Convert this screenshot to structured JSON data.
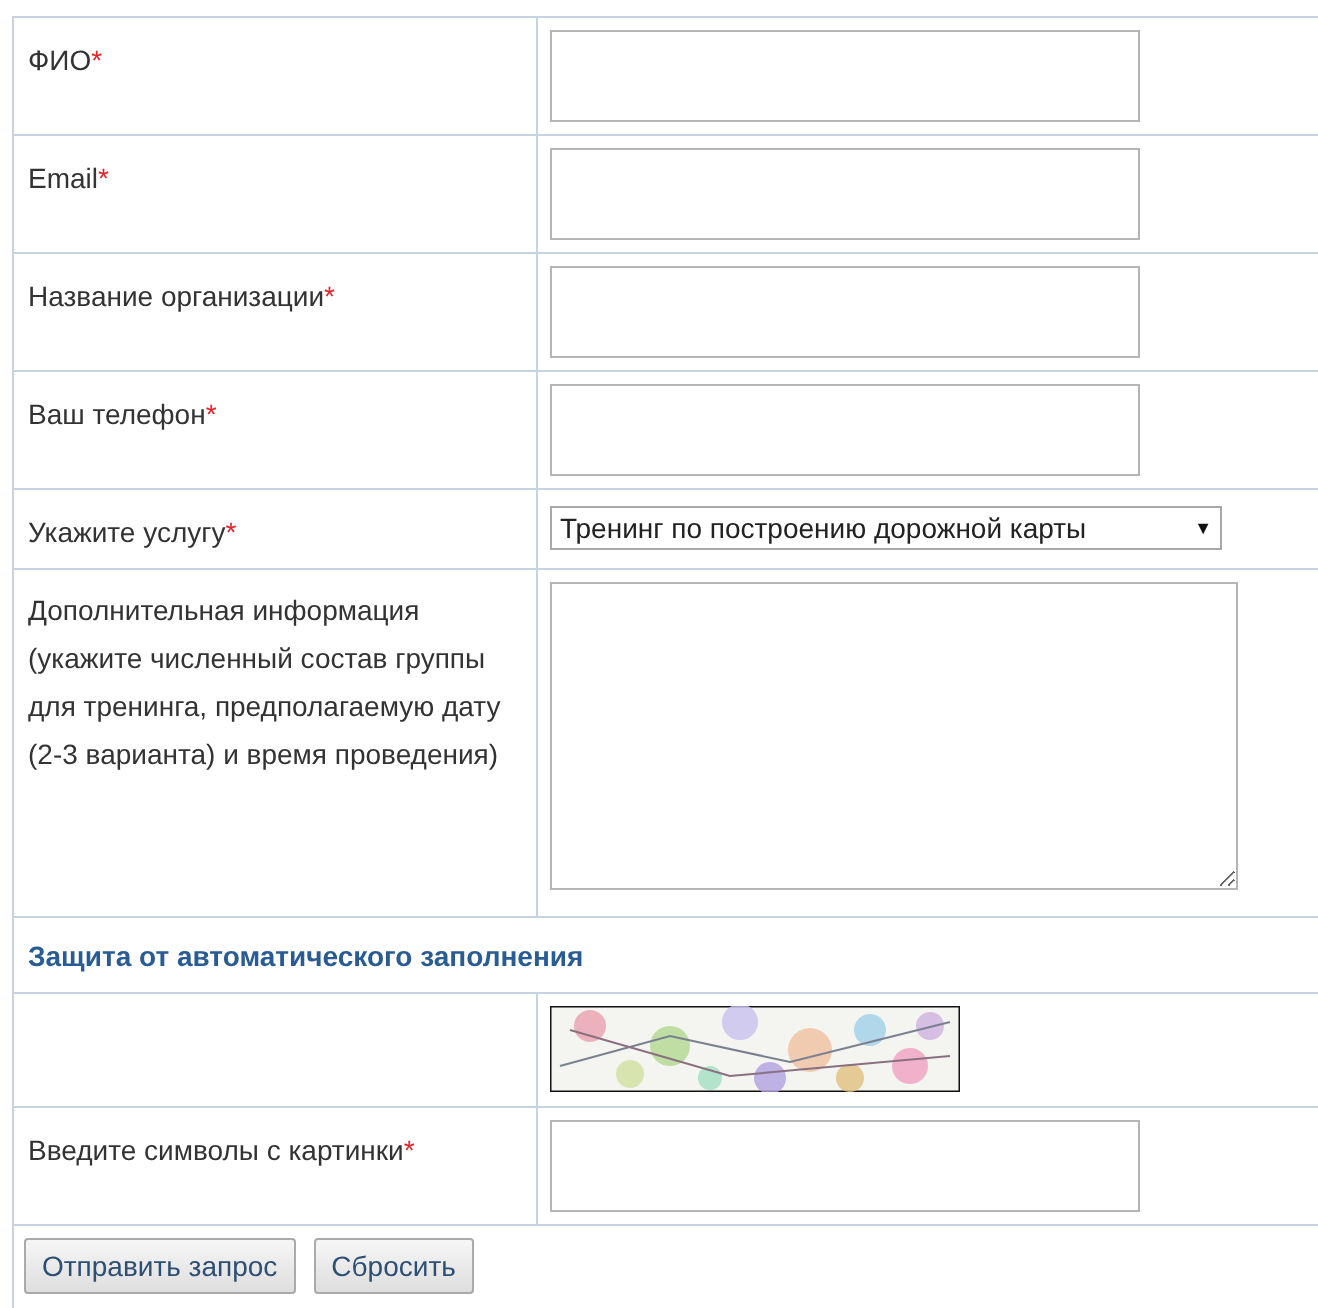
{
  "rows": [
    {
      "kind": "text",
      "label": "ФИО",
      "required_mark": "*"
    },
    {
      "kind": "text",
      "label": "Email",
      "required_mark": "*"
    },
    {
      "kind": "text",
      "label": "Название организации",
      "required_mark": "*"
    },
    {
      "kind": "text",
      "label": "Ваш телефон",
      "required_mark": "*"
    },
    {
      "kind": "select",
      "label": "Укажите услугу",
      "required_mark": "*",
      "value": "Тренинг по построению дорожной карты",
      "arrow": "▼"
    },
    {
      "kind": "textarea",
      "label": "Дополнительная информация (укажите численный состав группы для тренинга, предполагаемую дату (2-3 варианта) и время проведения)"
    },
    {
      "kind": "section",
      "label": "Защита от автоматического заполнения"
    },
    {
      "kind": "captcha"
    },
    {
      "kind": "text",
      "label": "Введите символы с картинки",
      "required_mark": "*"
    }
  ],
  "buttons": [
    "Отправить запрос",
    "Сбросить"
  ]
}
